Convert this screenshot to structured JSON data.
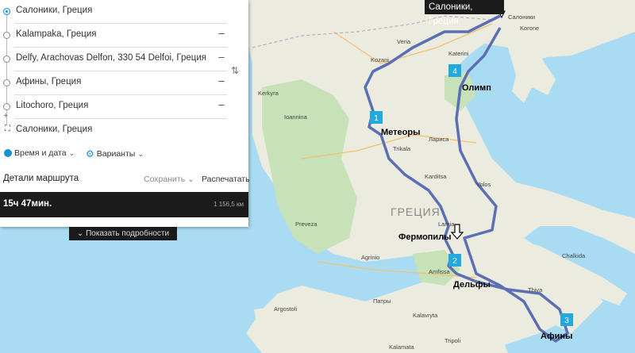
{
  "route_panel": {
    "stops": [
      {
        "name": "Салоники, Греция",
        "removable": false
      },
      {
        "name": "Kalampaka, Греция",
        "removable": true
      },
      {
        "name": "Delfy, Arachovas Delfon, 330 54 Delfoi, Греция",
        "removable": true
      },
      {
        "name": "Афины, Греция",
        "removable": true
      },
      {
        "name": "Litochoro, Греция",
        "removable": true
      },
      {
        "name": "Салоники, Греция",
        "removable": false
      }
    ],
    "remove_symbol": "–",
    "time_date_label": "Время и дата",
    "variants_label": "Варианты",
    "details_title": "Детали маршрута",
    "save_label": "Сохранить",
    "print_label": "Распечатать",
    "duration": "15ч 47мин.",
    "distance": "1 156,5 км",
    "show_details_label": "Показать подробности"
  },
  "map": {
    "callout": "Салоники, Греция",
    "country_label": "ГРЕЦИЯ",
    "annotations": [
      {
        "text": "Метеоры"
      },
      {
        "text": "Олимп"
      },
      {
        "text": "Фермопилы"
      },
      {
        "text": "Дельфы"
      },
      {
        "text": "Афины"
      }
    ],
    "waypoints": [
      "1",
      "2",
      "3",
      "4"
    ],
    "towns": [
      "Салоники",
      "Korone",
      "Kozani",
      "Trikala",
      "Лариса",
      "Ioannina",
      "Volos",
      "Karditsa",
      "Lamia",
      "Amfissa",
      "Chalkida",
      "Thiva",
      "Патры",
      "Agrinio",
      "Preveza",
      "Kalamata",
      "Tripoli",
      "Kerkyra",
      "Katerini",
      "Veria",
      "Kalavryta",
      "Argostoli"
    ],
    "route_color": "#5a6fb4",
    "marker_color": "#22a9e0"
  }
}
